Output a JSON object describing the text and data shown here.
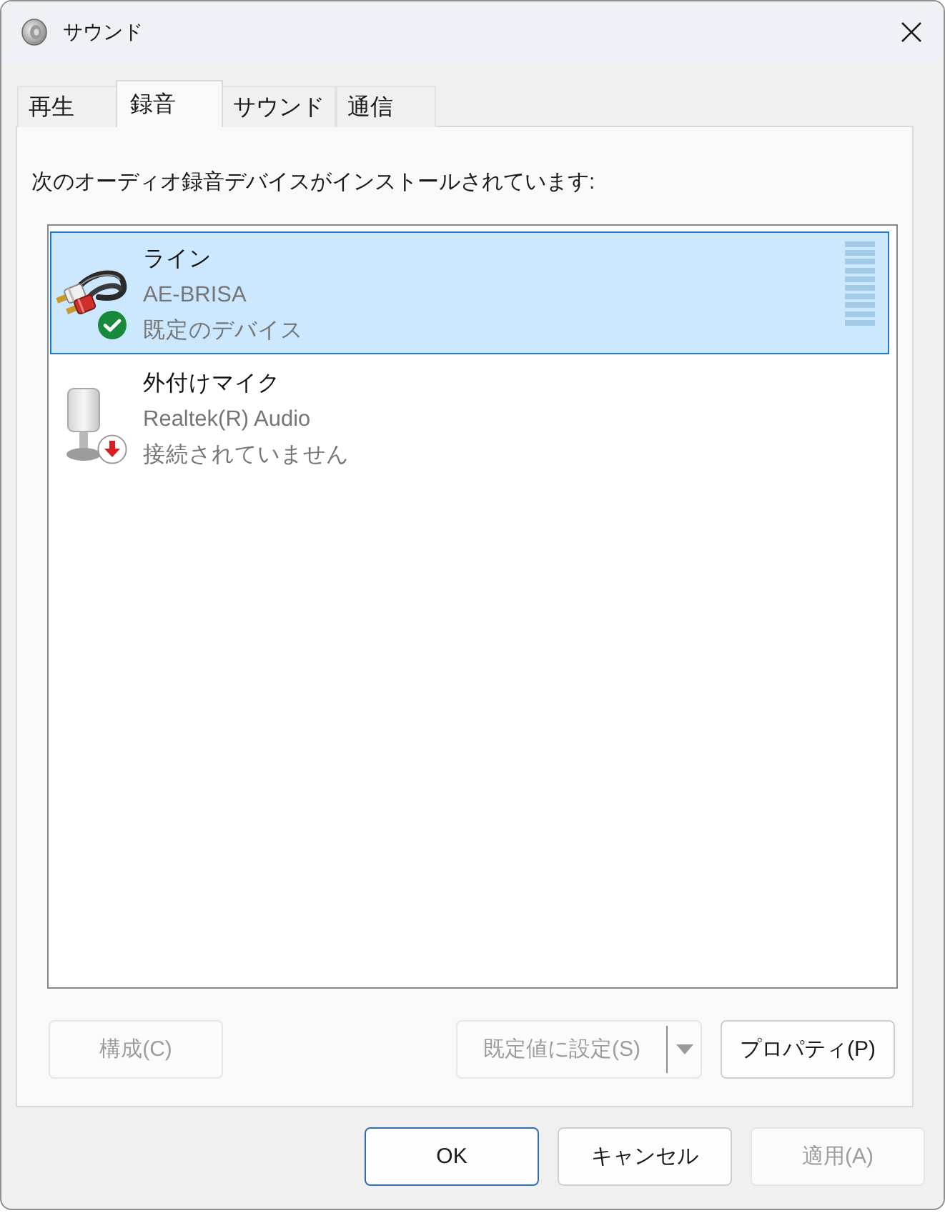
{
  "window": {
    "title": "サウンド"
  },
  "tabs": [
    {
      "label": "再生",
      "selected": false
    },
    {
      "label": "録音",
      "selected": true
    },
    {
      "label": "サウンド",
      "selected": false
    },
    {
      "label": "通信",
      "selected": false
    }
  ],
  "panel": {
    "caption": "次のオーディオ録音デバイスがインストールされています:",
    "devices": [
      {
        "kind": "line",
        "default": true,
        "connected": true,
        "name": "ライン",
        "driver": "AE-BRISA",
        "status": "既定のデバイス",
        "selected": true,
        "level": 0
      },
      {
        "kind": "microphone",
        "default": false,
        "connected": false,
        "name": "外付けマイク",
        "driver": "Realtek(R) Audio",
        "status": "接続されていません",
        "selected": false
      }
    ],
    "buttons": [
      {
        "kind": "button",
        "label": "構成(C)",
        "disabled": true
      },
      {
        "kind": "split",
        "label": "既定値に設定(S)",
        "disabled": true
      },
      {
        "kind": "button",
        "label": "プロパティ(P)",
        "disabled": false
      }
    ]
  },
  "footer_buttons": [
    {
      "label": "OK",
      "default": true,
      "disabled": false
    },
    {
      "label": "キャンセル",
      "default": false,
      "disabled": false
    },
    {
      "label": "適用(A)",
      "default": false,
      "disabled": true
    }
  ]
}
